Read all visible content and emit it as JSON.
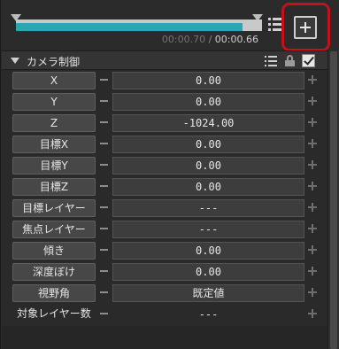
{
  "timeline": {
    "current_time": "00:00.70",
    "separator": " / ",
    "end_time": "00:00.66",
    "progress": 0.92,
    "list_icon": "list-icon",
    "add_icon": "plus-icon"
  },
  "section": {
    "title": "カメラ制御",
    "collapse_icon": "triangle-down-icon",
    "list_icon": "list-icon",
    "lock_icon": "lock-icon",
    "check_icon": "checkbox-checked-icon",
    "enabled": true
  },
  "colors": {
    "accent": "#2aa7b6",
    "highlight": "#c3101b"
  },
  "params": [
    {
      "label": "X",
      "value": "0.00",
      "button": true
    },
    {
      "label": "Y",
      "value": "0.00",
      "button": true
    },
    {
      "label": "Z",
      "value": "-1024.00",
      "button": true
    },
    {
      "label": "目標X",
      "value": "0.00",
      "button": true
    },
    {
      "label": "目標Y",
      "value": "0.00",
      "button": true
    },
    {
      "label": "目標Z",
      "value": "0.00",
      "button": true
    },
    {
      "label": "目標レイヤー",
      "value": "---",
      "button": true
    },
    {
      "label": "焦点レイヤー",
      "value": "---",
      "button": true
    },
    {
      "label": "傾き",
      "value": "0.00",
      "button": true
    },
    {
      "label": "深度ぼけ",
      "value": "0.00",
      "button": true
    },
    {
      "label": "視野角",
      "value": "既定値",
      "button": true
    },
    {
      "label": "対象レイヤー数",
      "value": "---",
      "button": false
    }
  ]
}
